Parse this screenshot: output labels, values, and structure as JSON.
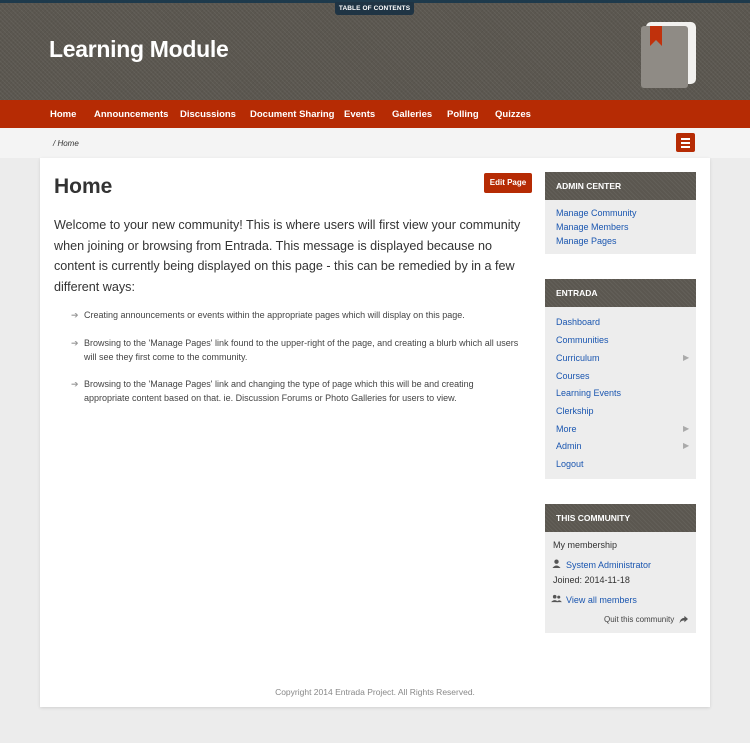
{
  "toc_label": "TABLE OF CONTENTS",
  "site_title": "Learning Module",
  "nav": [
    "Home",
    "Announcements",
    "Discussions",
    "Document Sharing",
    "Events",
    "Galleries",
    "Polling",
    "Quizzes"
  ],
  "breadcrumb": "/ Home",
  "page_title": "Home",
  "edit_button": "Edit Page",
  "welcome": "Welcome to your new community! This is where users will first view your community when joining or browsing from Entrada. This message is displayed because no content is currently being displayed on this page - this can be remedied by in a few different ways:",
  "ways": [
    "Creating announcements or events within the appropriate pages which will display on this page.",
    "Browsing to the 'Manage Pages' link found to the upper-right of the page, and creating a blurb which all users will see they first come to the community.",
    "Browsing to the 'Manage Pages' link and changing the type of page which this will be and creating appropriate content based on that. ie. Discussion Forums or Photo Galleries for users to view."
  ],
  "admin_center": {
    "title": "ADMIN CENTER",
    "links": [
      "Manage Community",
      "Manage Members",
      "Manage Pages"
    ]
  },
  "entrada": {
    "title": "ENTRADA",
    "links": [
      "Dashboard",
      "Communities",
      "Curriculum",
      "Courses",
      "Learning Events",
      "Clerkship",
      "More",
      "Admin",
      "Logout"
    ]
  },
  "this_community": {
    "title": "THIS COMMUNITY",
    "membership_label": "My membership",
    "user_name": "System Administrator",
    "joined": "Joined: 2014-11-18",
    "view_all": "View all members",
    "quit": "Quit this community"
  },
  "footer": "Copyright 2014 Entrada Project. All Rights Reserved.",
  "colors": {
    "accent": "#b62b04",
    "header_bg": "#5b5750",
    "link": "#1a56b0"
  }
}
